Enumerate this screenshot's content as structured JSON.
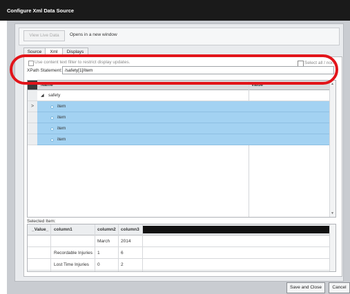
{
  "window": {
    "title": "Configure Xml Data Source"
  },
  "toolbar": {
    "view_live_data": "View Live Data",
    "opens_new_window": "Opens in a new window"
  },
  "tabs": [
    {
      "label": "Source"
    },
    {
      "label": "Xml"
    },
    {
      "label": "Displays"
    }
  ],
  "options": {
    "hint": "Use content text filter to restrict display updates.",
    "select_all": "Select all / none"
  },
  "xpath": {
    "label": "XPath Statement:",
    "value": "/safety[1]/item"
  },
  "tree": {
    "columns": [
      "Name",
      "Value"
    ],
    "rows": [
      {
        "expander": "◢",
        "label": "safety",
        "selected": false,
        "indicator": ""
      },
      {
        "label": "item",
        "selected": true,
        "indicator": ">"
      },
      {
        "label": "item",
        "selected": true,
        "indicator": ""
      },
      {
        "label": "item",
        "selected": true,
        "indicator": ""
      },
      {
        "label": "item",
        "selected": true,
        "indicator": ""
      }
    ]
  },
  "selected_item": {
    "label": "Selected Item:",
    "columns": [
      "_Value_",
      "column1",
      "column2",
      "column3"
    ],
    "rows": [
      [
        "",
        "",
        "March",
        "2014"
      ],
      [
        "",
        "Recordable Injuries",
        "1",
        "6"
      ],
      [
        "",
        "Lost Time Injuries",
        "0",
        "2"
      ]
    ]
  },
  "buttons": {
    "save_close": "Save and Close",
    "cancel": "Cancel"
  },
  "colors": {
    "selection": "#a3d2f2",
    "highlight_ring": "#e2141a",
    "titlebar": "#1a1a1a"
  }
}
